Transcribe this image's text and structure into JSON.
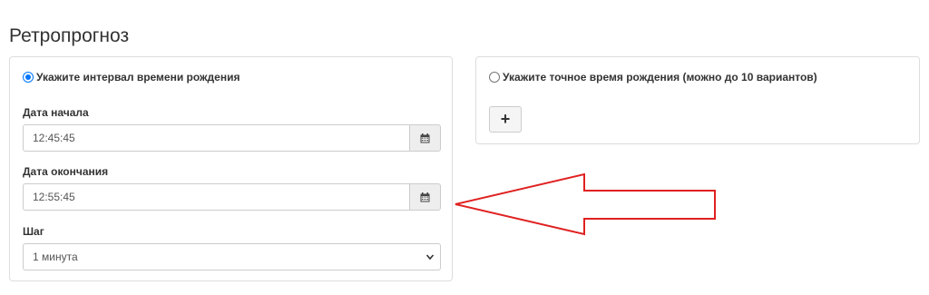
{
  "title": "Ретропрогноз",
  "left_panel": {
    "radio_label": "Укажите интервал времени рождения",
    "radio_checked": true,
    "start": {
      "label": "Дата начала",
      "value": "12:45:45"
    },
    "end": {
      "label": "Дата окончания",
      "value": "12:55:45"
    },
    "step": {
      "label": "Шаг",
      "selected": "1 минута"
    }
  },
  "right_panel": {
    "radio_label": "Укажите точное время рождения (можно до 10 вариантов)",
    "radio_checked": false,
    "add_button_label": "+"
  },
  "icons": {
    "calendar": "calendar-icon",
    "chevron": "chevron-down-icon",
    "annotation": "red-arrow-annotation"
  },
  "colors": {
    "accent": "#0075ff",
    "annotation": "#e02020",
    "border": "#dddddd"
  }
}
